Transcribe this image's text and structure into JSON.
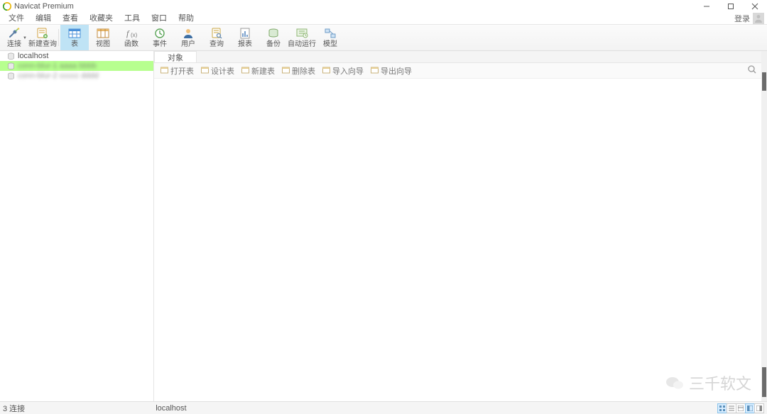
{
  "title": "Navicat Premium",
  "menu": [
    "文件",
    "编辑",
    "查看",
    "收藏夹",
    "工具",
    "窗口",
    "帮助"
  ],
  "login_label": "登录",
  "toolbar": [
    {
      "id": "connect",
      "label": "连接",
      "hasDropdown": true
    },
    {
      "id": "newquery",
      "label": "新建查询"
    },
    {
      "sep": true
    },
    {
      "id": "table",
      "label": "表",
      "active": true
    },
    {
      "id": "view",
      "label": "视图"
    },
    {
      "id": "function",
      "label": "函数"
    },
    {
      "id": "event",
      "label": "事件"
    },
    {
      "id": "user",
      "label": "用户"
    },
    {
      "id": "query",
      "label": "查询"
    },
    {
      "id": "report",
      "label": "报表"
    },
    {
      "id": "backup",
      "label": "备份"
    },
    {
      "id": "automation",
      "label": "自动运行"
    },
    {
      "id": "model",
      "label": "模型"
    }
  ],
  "connections": [
    {
      "name": "localhost",
      "selected": false,
      "blur": false
    },
    {
      "name": "conn-blur-1 aaaa bbbb",
      "selected": true,
      "blur": true
    },
    {
      "name": "conn-blur-2 ccccc dddd",
      "selected": false,
      "blur": true
    }
  ],
  "tabs": [
    {
      "label": "对象"
    }
  ],
  "subtoolbar": [
    "打开表",
    "设计表",
    "新建表",
    "删除表",
    "导入向导",
    "导出向导"
  ],
  "status": {
    "left": "3 连接",
    "conn": "localhost"
  },
  "watermark": "三千软文"
}
